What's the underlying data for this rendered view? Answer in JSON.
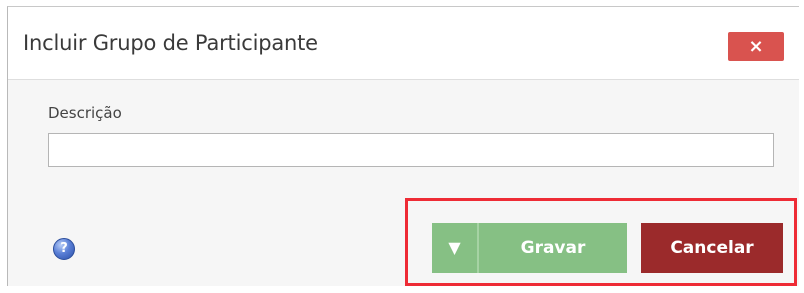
{
  "dialog": {
    "title": "Incluir Grupo de Participante",
    "close_label": "×"
  },
  "form": {
    "description_label": "Descrição",
    "description_value": "",
    "description_placeholder": ""
  },
  "footer": {
    "help_label": "?",
    "dropdown_label": "▼",
    "save_label": "Gravar",
    "cancel_label": "Cancelar"
  },
  "colors": {
    "close": "#d9534f",
    "save": "#86c084",
    "cancel": "#9b2a2b",
    "highlight": "#ee2b35"
  },
  "icons": {
    "close": "close-icon",
    "help": "help-icon",
    "dropdown": "caret-down-icon"
  }
}
